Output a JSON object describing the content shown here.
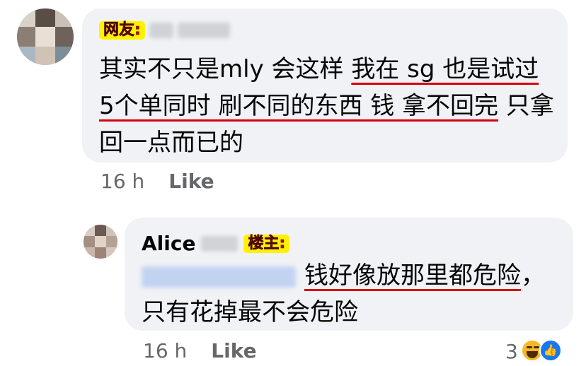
{
  "comment": {
    "tag": "网友:",
    "text_plain_1": "其实不只是mly 会这样 ",
    "text_ul_1": "我在 sg 也是试过 5个单同时 刷不同的东西 钱 拿不回完",
    "text_plain_2": " 只拿回一点而已的",
    "time": "16 h",
    "like_label": "Like"
  },
  "reply": {
    "author": "Alice",
    "tag": "楼主:",
    "text_ul_1": "钱好像放那里都危险",
    "text_plain_1": "，只有花掉最不会危险",
    "time": "16 h",
    "like_label": "Like",
    "reaction_count": "3",
    "reaction_icons": [
      "haha-icon",
      "like-icon"
    ]
  },
  "colors": {
    "bubble": "#f0f2f5",
    "tag_bg": "#fff200",
    "tag_text": "#c4000c",
    "underline": "#d8000c",
    "meta_text": "#65676b",
    "like_blue": "#1877f2"
  }
}
